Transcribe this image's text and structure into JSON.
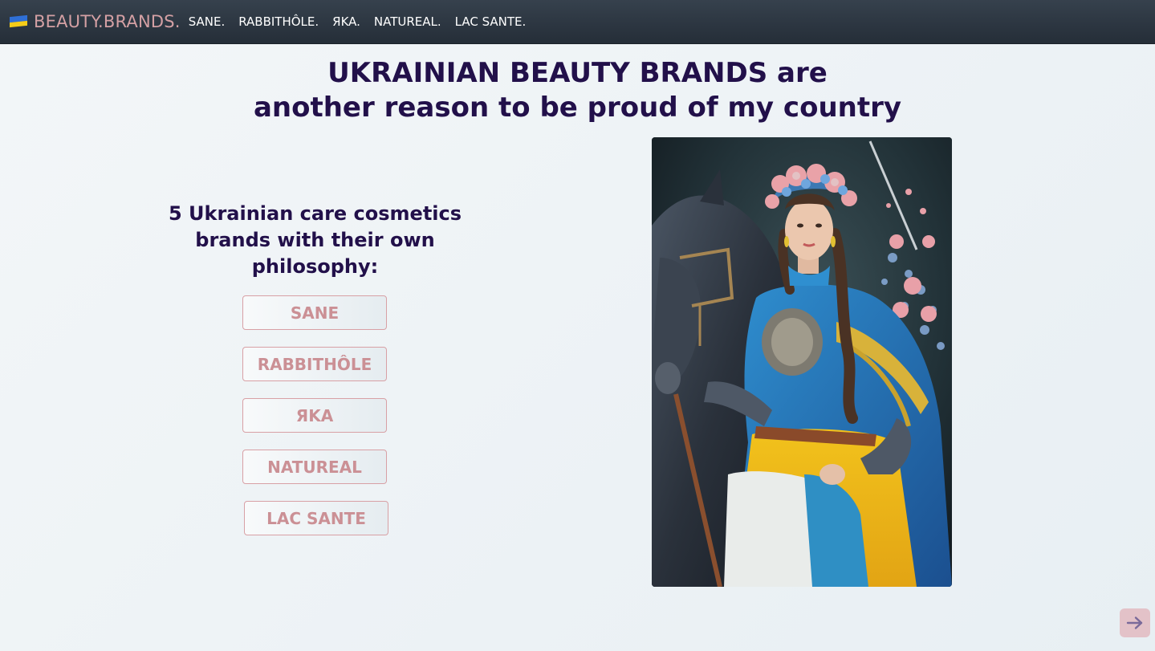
{
  "nav": {
    "brand": "BEAUTY.BRANDS.",
    "links": [
      "SANE.",
      "RABBITHÔLE.",
      "ЯKA.",
      "NATUREAL.",
      "LAC SANTE."
    ]
  },
  "headline": {
    "line1": "UKRAINIAN BEAUTY BRANDS are",
    "line2": "another reason to be proud of my country"
  },
  "subhead": "5 Ukrainian care cosmetics brands with their own philosophy:",
  "brand_buttons": [
    "SANE",
    "RABBITHÔLE",
    "ЯKA",
    "NATUREAL",
    "LAC SANTE"
  ],
  "icons": {
    "flag": "ukraine-flag-icon",
    "next": "arrow-right-icon"
  },
  "colors": {
    "accent_pink": "#d4a0a4",
    "headline": "#22104a",
    "nav_bg": "#2a333d"
  }
}
